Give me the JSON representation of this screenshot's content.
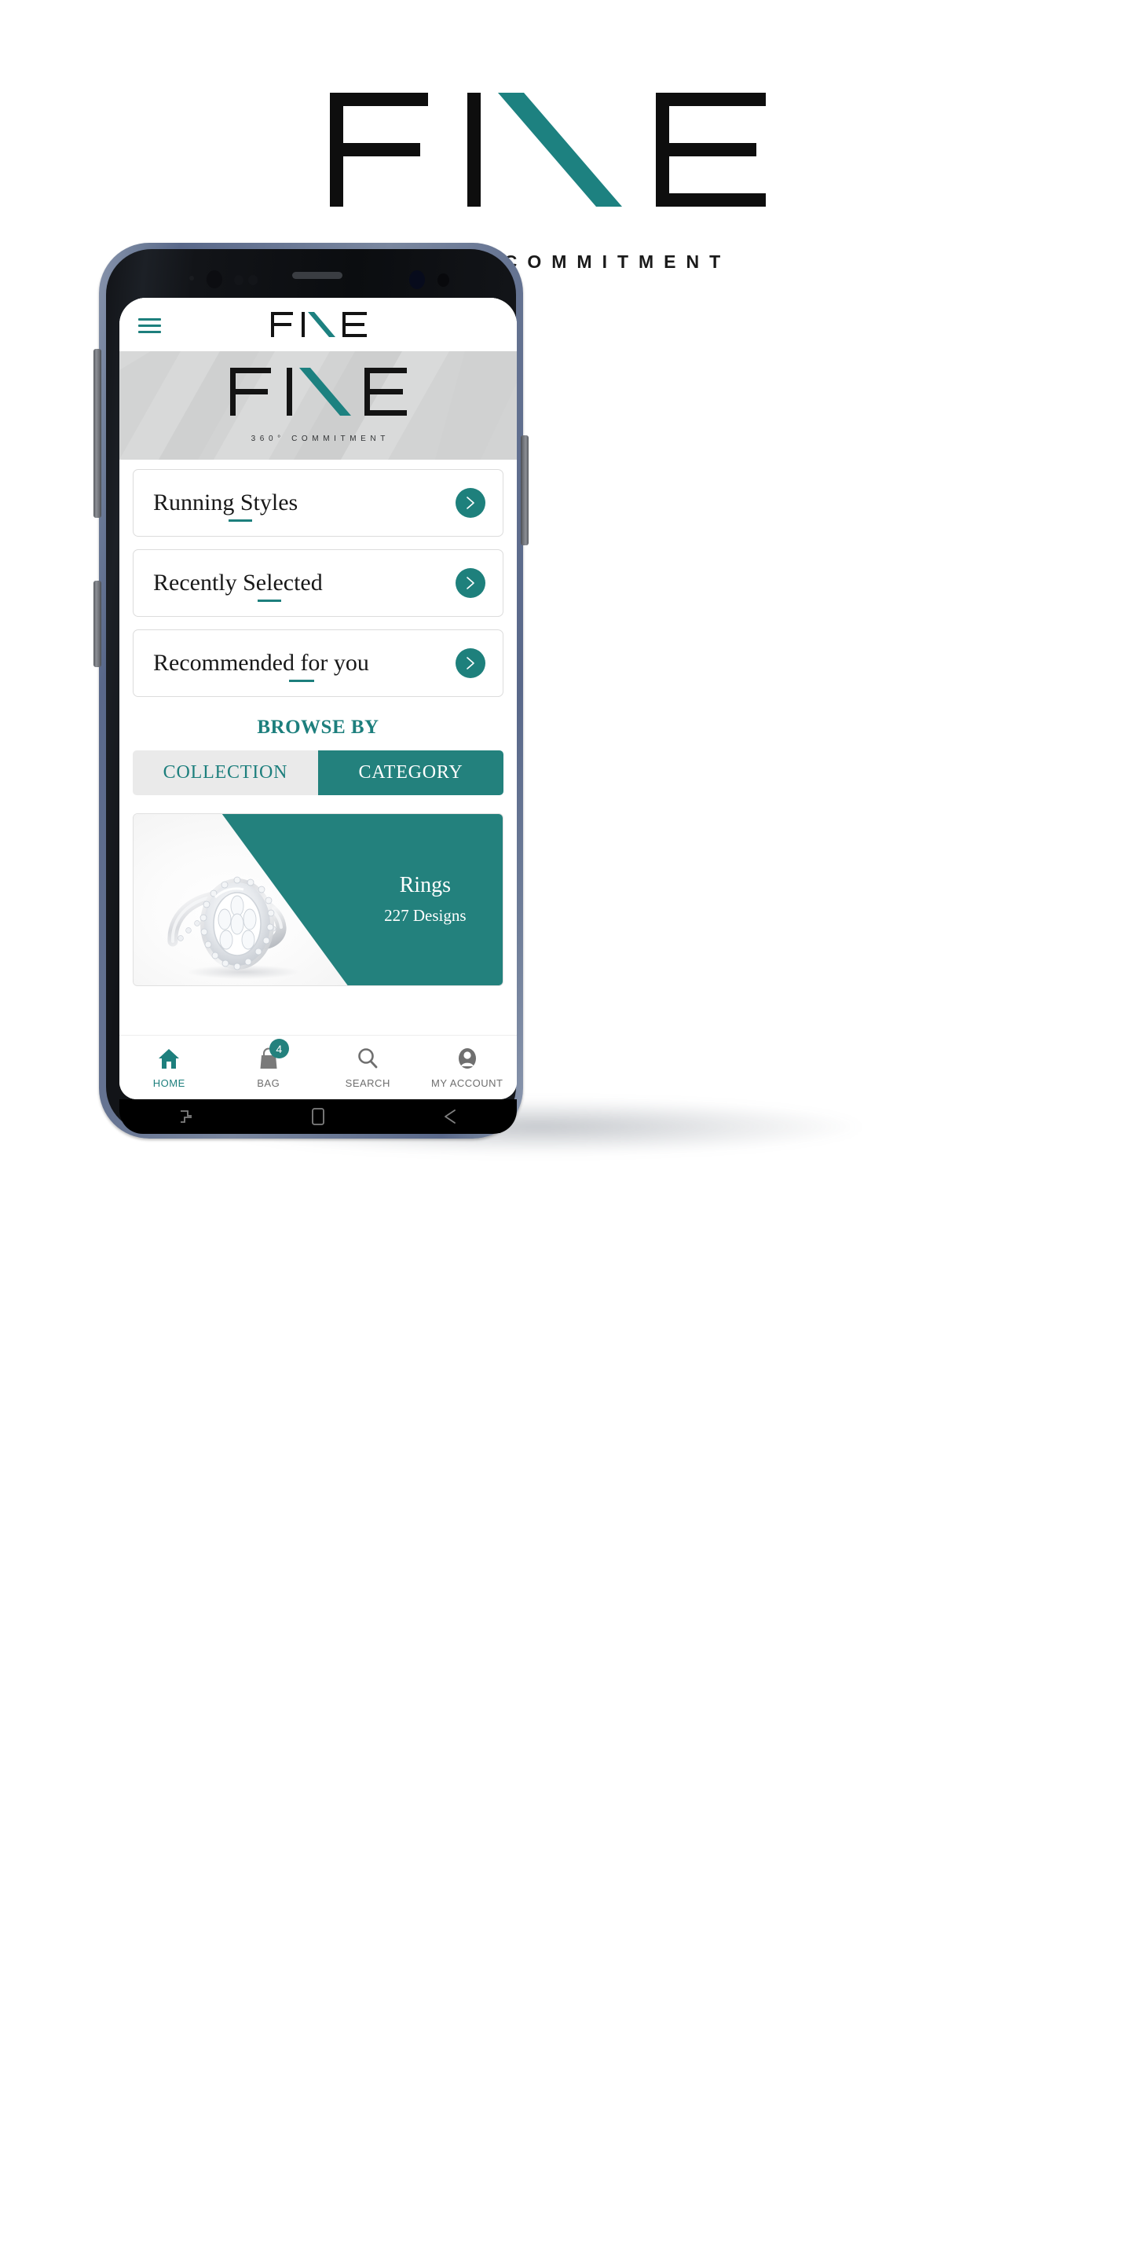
{
  "brand": {
    "wordmark": "FINE",
    "tagline": "360° COMMITMENT",
    "accent_color": "#1d7f7d"
  },
  "app": {
    "header": {
      "menu_icon": "hamburger-icon",
      "logo_text": "FINE"
    },
    "hero": {
      "logo_text": "FINE",
      "tagline": "360° COMMITMENT",
      "background_color": "#d2d3d3"
    },
    "menu_cards": [
      {
        "label": "Running Styles",
        "chevron": "chevron-right-icon",
        "underline_start": 96,
        "underline_width": 30
      },
      {
        "label": "Recently Selected",
        "chevron": "chevron-right-icon",
        "underline_start": 133,
        "underline_width": 30
      },
      {
        "label": "Recommended for you",
        "chevron": "chevron-right-icon",
        "underline_start": 173,
        "underline_width": 32
      }
    ],
    "browse": {
      "title": "BROWSE BY",
      "tabs": [
        {
          "label": "COLLECTION",
          "active": false
        },
        {
          "label": "CATEGORY",
          "active": true
        }
      ]
    },
    "product": {
      "title": "Rings",
      "subtitle": "227 Designs",
      "image": "diamond-halo-ring",
      "overlay_color": "#23817d"
    },
    "bottom_nav": [
      {
        "label": "HOME",
        "icon": "home-icon",
        "active": true,
        "badge": null
      },
      {
        "label": "BAG",
        "icon": "bag-icon",
        "active": false,
        "badge": "4"
      },
      {
        "label": "SEARCH",
        "icon": "search-icon",
        "active": false,
        "badge": null
      },
      {
        "label": "MY ACCOUNT",
        "icon": "person-icon",
        "active": false,
        "badge": null
      }
    ]
  },
  "android_nav": [
    {
      "name": "recents-button"
    },
    {
      "name": "home-button"
    },
    {
      "name": "back-button"
    }
  ]
}
